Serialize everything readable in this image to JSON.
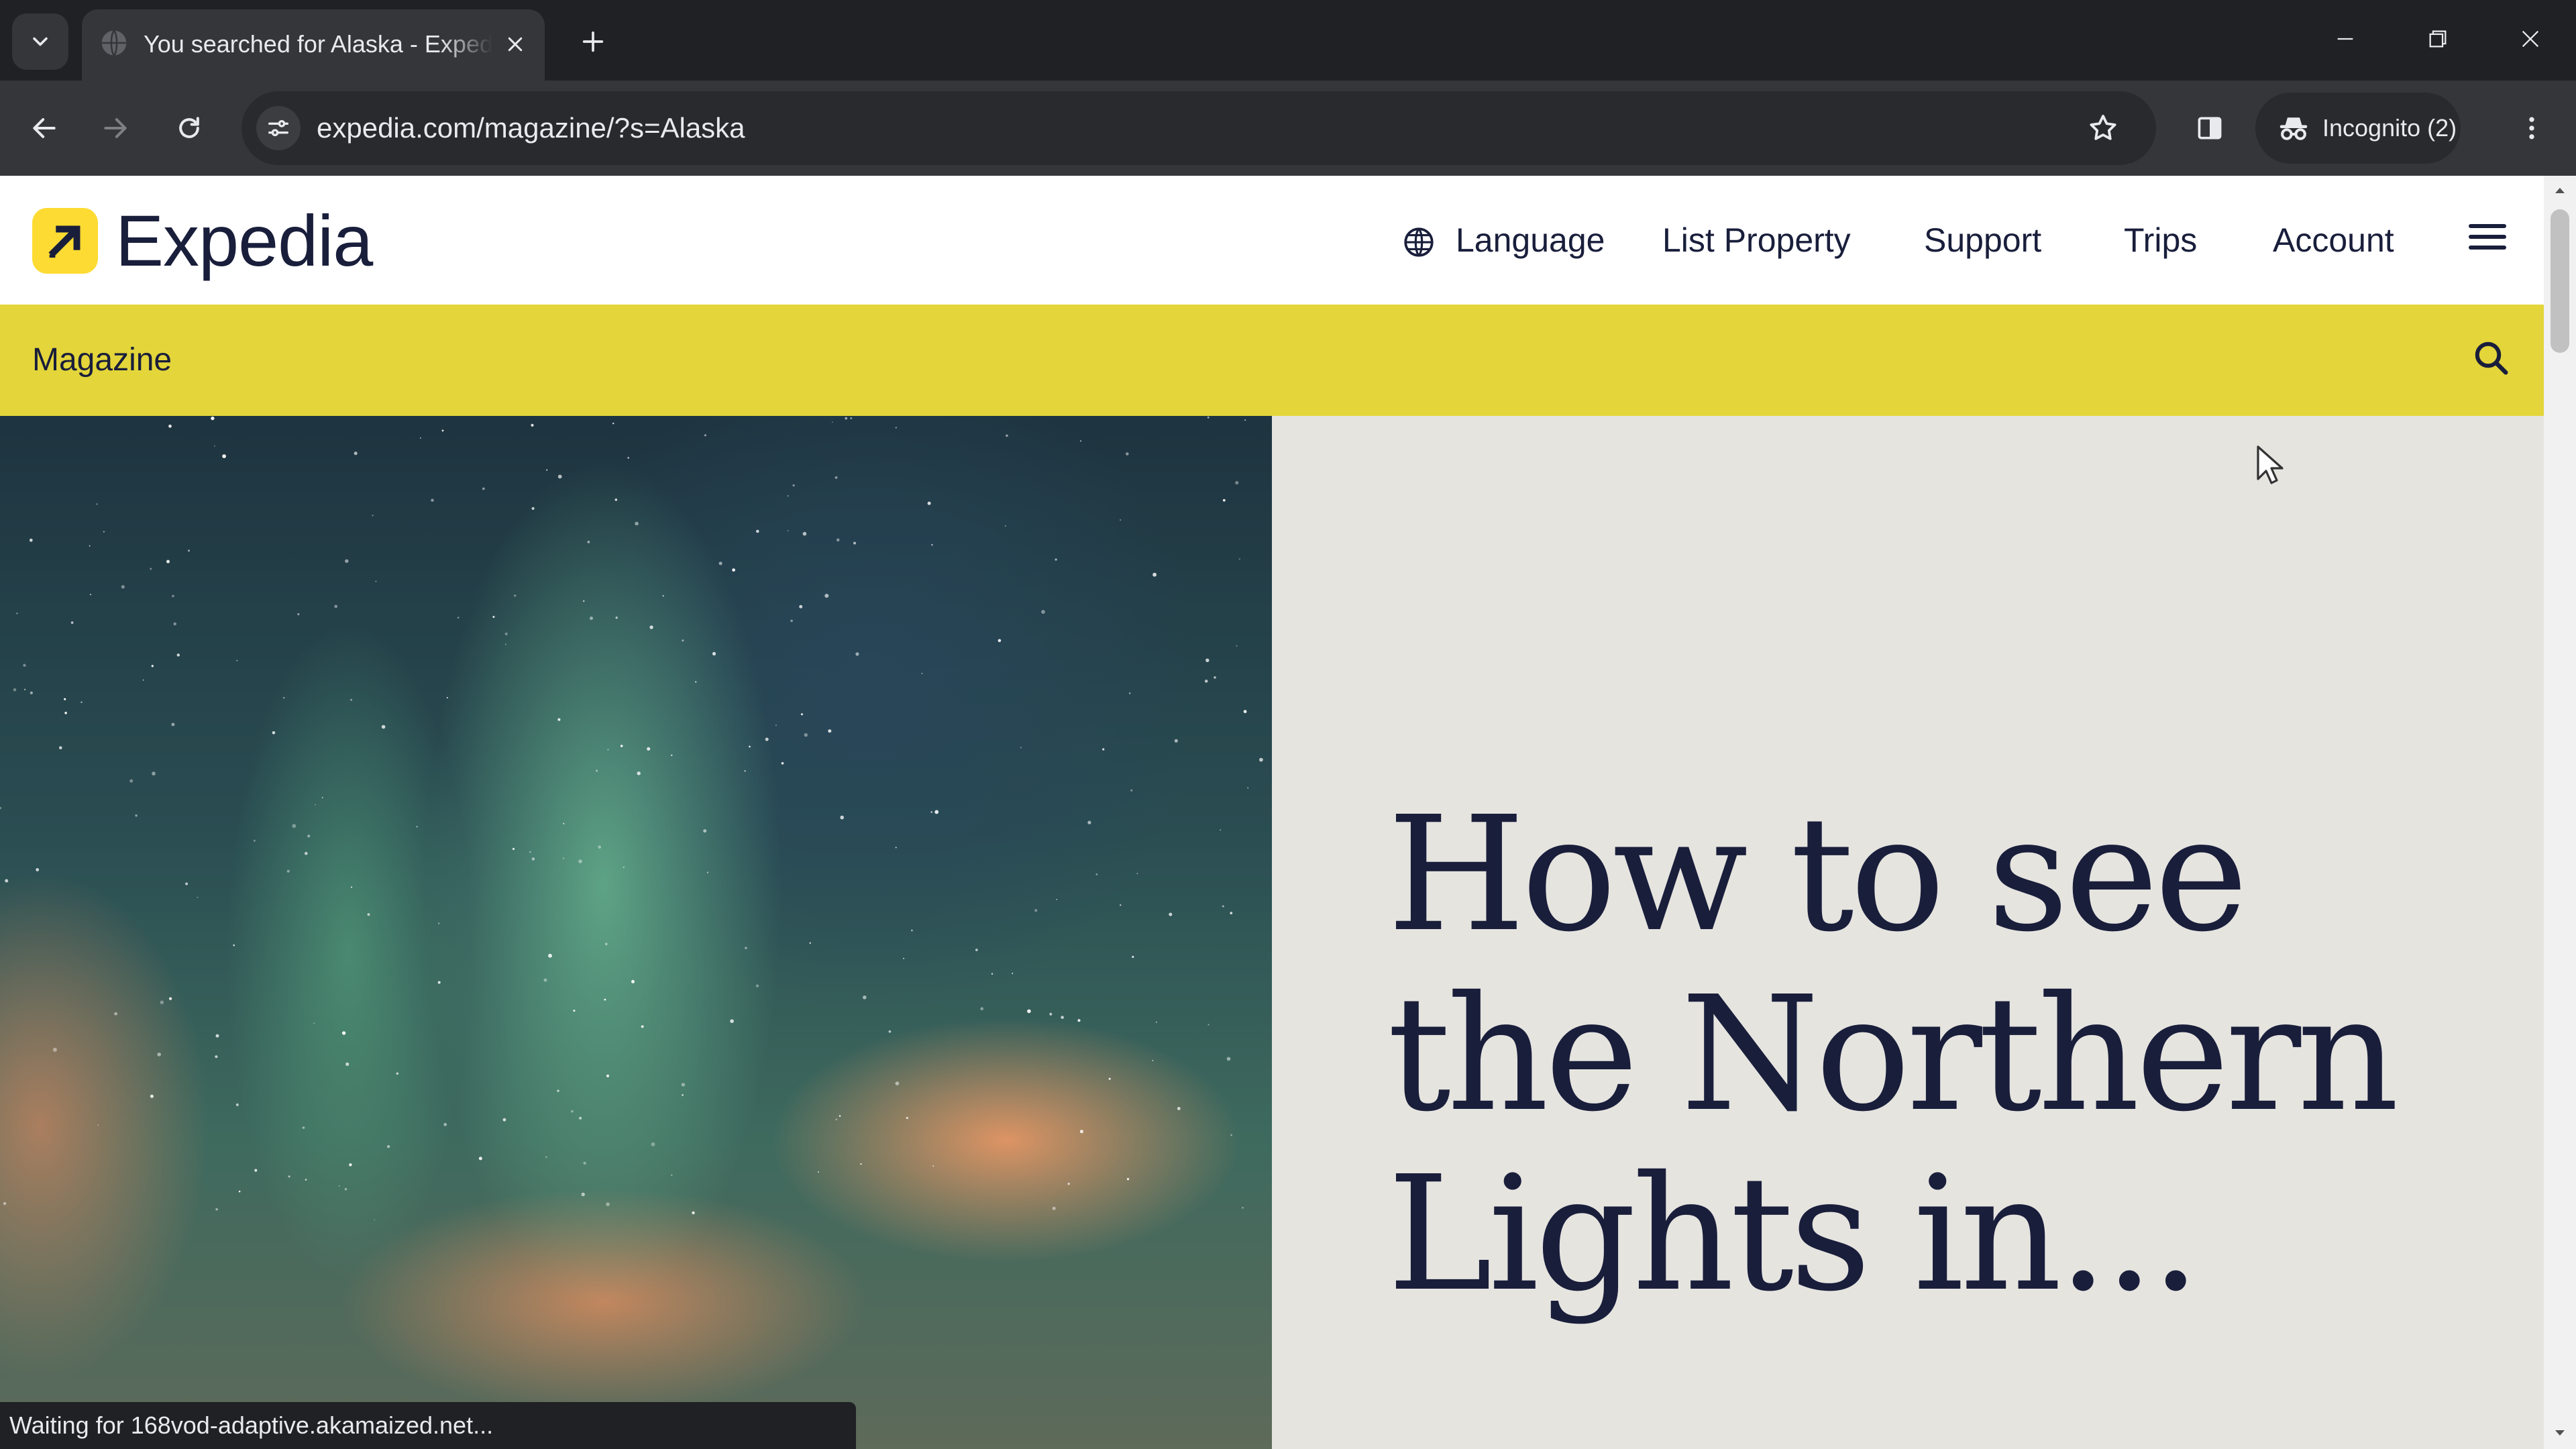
{
  "browser": {
    "tab": {
      "title": "You searched for Alaska - Expedia"
    },
    "url": "expedia.com/magazine/?s=Alaska",
    "profile_label": "Incognito (2)",
    "status_text": "Waiting for 168vod-adaptive.akamaized.net..."
  },
  "site": {
    "brand": "Expedia",
    "brand_color": "#fddb32",
    "nav": {
      "language": "Language",
      "list_property": "List Property",
      "support": "Support",
      "trips": "Trips",
      "account": "Account"
    },
    "section_label": "Magazine",
    "section_bar_color": "#e3d53a",
    "hero": {
      "title": "How to see the Northern Lights in..."
    }
  }
}
